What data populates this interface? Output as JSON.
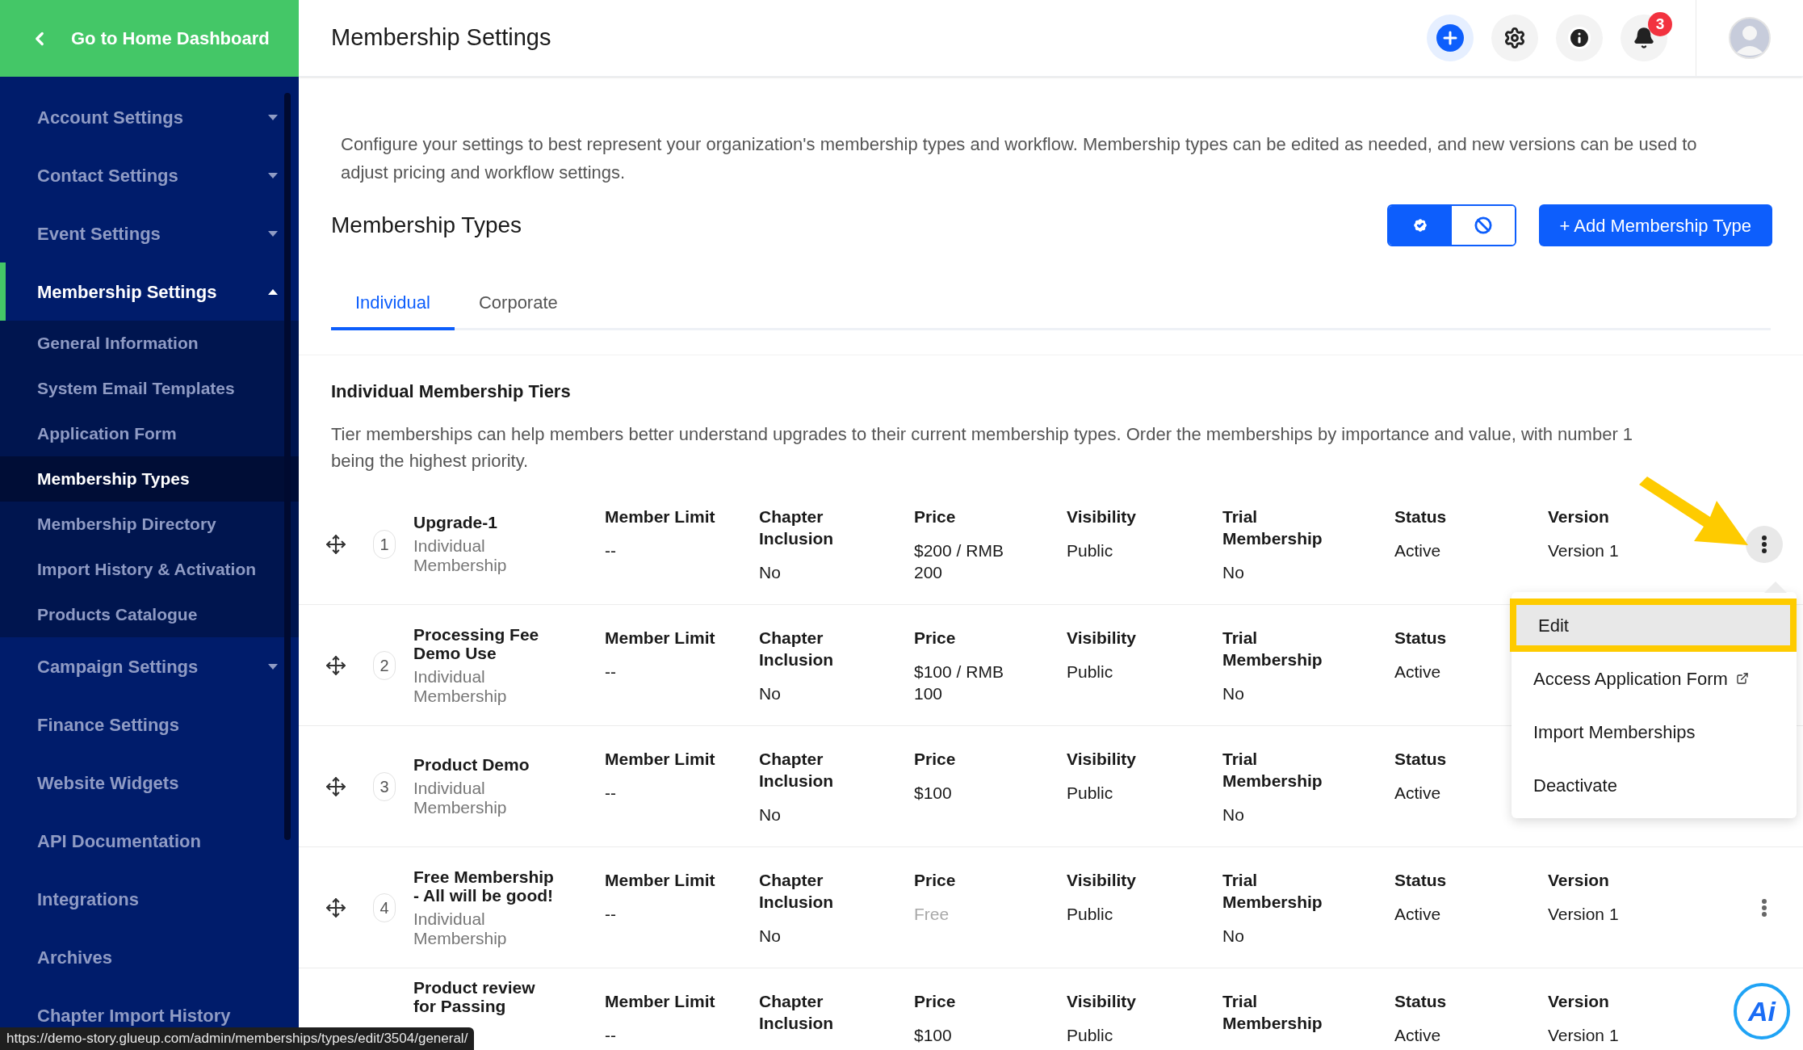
{
  "sidebar": {
    "home_link": "Go to Home Dashboard",
    "items": [
      {
        "label": "Account Settings",
        "expanded": false,
        "has_children": true
      },
      {
        "label": "Contact Settings",
        "expanded": false,
        "has_children": true
      },
      {
        "label": "Event Settings",
        "expanded": false,
        "has_children": true
      },
      {
        "label": "Membership Settings",
        "expanded": true,
        "has_children": true,
        "children": [
          {
            "label": "General Information",
            "selected": false
          },
          {
            "label": "System Email Templates",
            "selected": false
          },
          {
            "label": "Application Form",
            "selected": false
          },
          {
            "label": "Membership Types",
            "selected": true
          },
          {
            "label": "Membership Directory",
            "selected": false
          },
          {
            "label": "Import History & Activation",
            "selected": false
          },
          {
            "label": "Products Catalogue",
            "selected": false
          }
        ]
      },
      {
        "label": "Campaign Settings",
        "expanded": false,
        "has_children": true
      },
      {
        "label": "Finance Settings",
        "expanded": false,
        "has_children": false
      },
      {
        "label": "Website Widgets",
        "expanded": false,
        "has_children": false
      },
      {
        "label": "API Documentation",
        "expanded": false,
        "has_children": false
      },
      {
        "label": "Integrations",
        "expanded": false,
        "has_children": false
      },
      {
        "label": "Archives",
        "expanded": false,
        "has_children": false
      },
      {
        "label": "Chapter Import History",
        "expanded": false,
        "has_children": false
      }
    ]
  },
  "header": {
    "title": "Membership Settings",
    "notification_count": "3"
  },
  "description": "Configure your settings to best represent your organization's membership types and workflow. Membership types can be edited as needed, and new versions can be used to adjust pricing and workflow settings.",
  "section": {
    "title": "Membership Types",
    "add_button": "+ Add Membership Type",
    "filters": [
      {
        "kind": "active",
        "selected": true
      },
      {
        "kind": "inactive",
        "selected": false
      }
    ]
  },
  "tabs": [
    {
      "label": "Individual",
      "selected": true
    },
    {
      "label": "Corporate",
      "selected": false
    }
  ],
  "tiers": {
    "title": "Individual Membership Tiers",
    "description": "Tier memberships can help members better understand upgrades to their current membership types. Order the memberships by importance and value, with number 1 being the highest priority."
  },
  "rows": [
    {
      "number": "1",
      "name": "Upgrade-1",
      "subtitle": "Individual Membership",
      "menu_open": true,
      "cells": [
        {
          "label": "Member Limit",
          "value": "--",
          "muted": false
        },
        {
          "label": "Chapter Inclusion",
          "value": "No",
          "muted": false
        },
        {
          "label": "Price",
          "value": "$200 / RMB 200",
          "muted": false
        },
        {
          "label": "Visibility",
          "value": "Public",
          "muted": false
        },
        {
          "label": "Trial Membership",
          "value": "No",
          "muted": false
        },
        {
          "label": "Status",
          "value": "Active",
          "muted": false
        },
        {
          "label": "Version",
          "value": "Version 1",
          "muted": false
        }
      ]
    },
    {
      "number": "2",
      "name": "Processing Fee Demo Use",
      "subtitle": "Individual Membership",
      "cells": [
        {
          "label": "Member Limit",
          "value": "--",
          "muted": false
        },
        {
          "label": "Chapter Inclusion",
          "value": "No",
          "muted": false
        },
        {
          "label": "Price",
          "value": "$100 / RMB 100",
          "muted": false
        },
        {
          "label": "Visibility",
          "value": "Public",
          "muted": false
        },
        {
          "label": "Trial Membership",
          "value": "No",
          "muted": false
        },
        {
          "label": "Status",
          "value": "Active",
          "muted": false
        }
      ]
    },
    {
      "number": "3",
      "name": "Product Demo",
      "subtitle": "Individual Membership",
      "cells": [
        {
          "label": "Member Limit",
          "value": "--",
          "muted": false
        },
        {
          "label": "Chapter Inclusion",
          "value": "No",
          "muted": false
        },
        {
          "label": "Price",
          "value": "$100",
          "muted": false
        },
        {
          "label": "Visibility",
          "value": "Public",
          "muted": false
        },
        {
          "label": "Trial Membership",
          "value": "No",
          "muted": false
        },
        {
          "label": "Status",
          "value": "Active",
          "muted": false
        }
      ]
    },
    {
      "number": "4",
      "name": "Free Membership - All will be good!",
      "subtitle": "Individual Membership",
      "menu_open": false,
      "cells": [
        {
          "label": "Member Limit",
          "value": "--",
          "muted": false
        },
        {
          "label": "Chapter Inclusion",
          "value": "No",
          "muted": false
        },
        {
          "label": "Price",
          "value": "Free",
          "muted": true
        },
        {
          "label": "Visibility",
          "value": "Public",
          "muted": false
        },
        {
          "label": "Trial Membership",
          "value": "No",
          "muted": false
        },
        {
          "label": "Status",
          "value": "Active",
          "muted": false
        },
        {
          "label": "Version",
          "value": "Version 1",
          "muted": false
        }
      ]
    },
    {
      "name": "Product review for Passing",
      "cells": [
        {
          "label": "Member Limit",
          "value": "--",
          "muted": false
        },
        {
          "label": "Chapter Inclusion"
        },
        {
          "label": "Price",
          "value": "$100",
          "muted": false
        },
        {
          "label": "Visibility",
          "value": "Public",
          "muted": false
        },
        {
          "label": "Trial Membership"
        },
        {
          "label": "Status",
          "value": "Active",
          "muted": false
        },
        {
          "label": "Version",
          "value": "Version 1",
          "muted": false
        }
      ]
    }
  ],
  "row_menu": {
    "items": [
      {
        "label": "Edit",
        "selected": true,
        "external": false
      },
      {
        "label": "Access Application Form",
        "selected": false,
        "external": true
      },
      {
        "label": "Import Memberships",
        "selected": false,
        "external": false
      },
      {
        "label": "Deactivate",
        "selected": false,
        "external": false
      }
    ]
  },
  "assistant_button": {
    "label": "Ai"
  },
  "status_url": "https://demo-story.glueup.com/admin/memberships/types/edit/3504/general/"
}
